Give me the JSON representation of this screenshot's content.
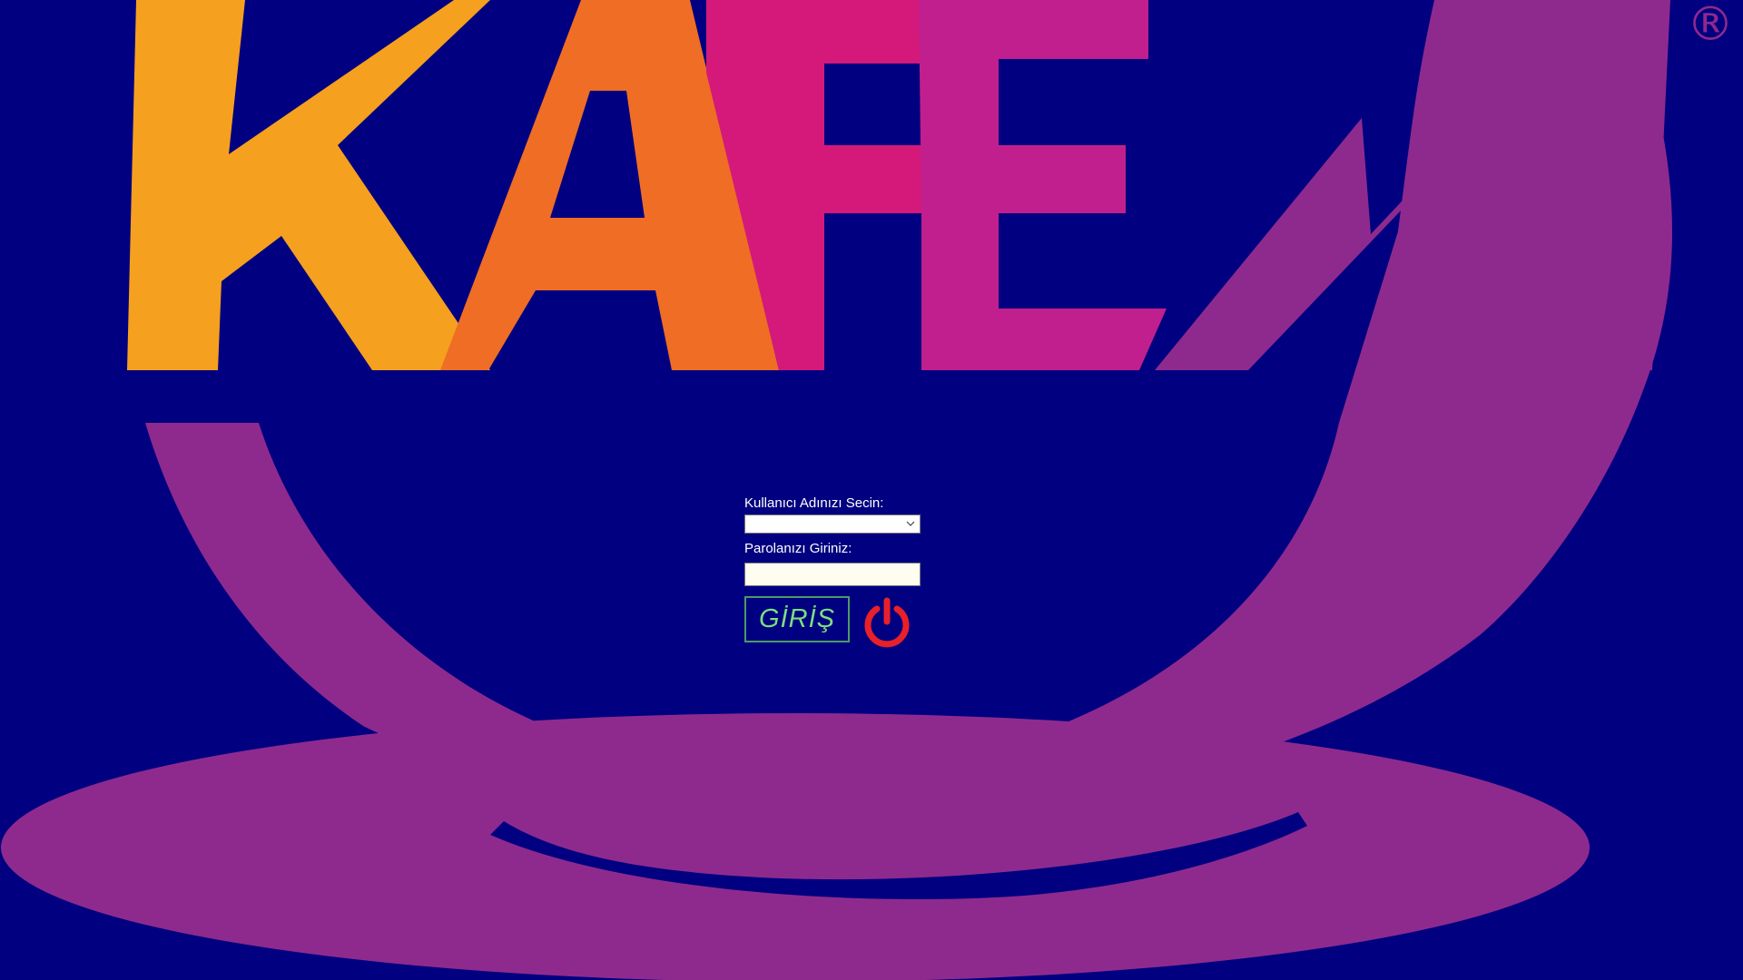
{
  "branding": {
    "logo_text": "KAFEM",
    "logo_mark": "®",
    "colors": {
      "background": "#000080",
      "k": "#f5a01e",
      "a": "#ef6d25",
      "f": "#d4197a",
      "e": "#c11f8d",
      "m": "#8e2a8e",
      "cup": "#8e2a8e"
    }
  },
  "login": {
    "username_label": "Kullanıcı Adınızı Secin:",
    "username_value": "",
    "password_label": "Parolanızı Giriniz:",
    "password_value": "",
    "login_button_label": "GİRİŞ",
    "power_icon": "power-icon",
    "colors": {
      "label": "#ffffff",
      "login_text": "#7ddf7d",
      "login_border": "#4f9b62",
      "power": "#e8202a"
    }
  }
}
